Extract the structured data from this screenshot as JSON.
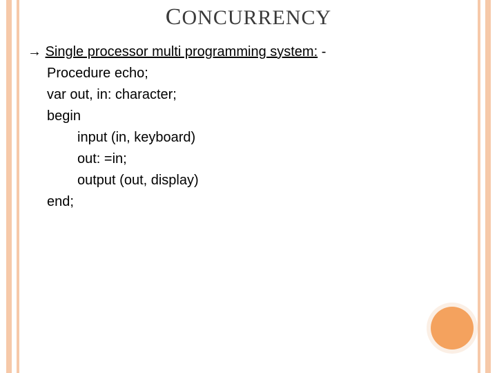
{
  "title": {
    "firstChar": "C",
    "rest": "ONCURRENCY"
  },
  "bullet_arrow": "→",
  "heading": "Single processor multi programming system:",
  "heading_suffix": " -",
  "lines": {
    "l1": "Procedure echo;",
    "l2": "var out, in: character;",
    "l3": "begin",
    "l4": "input (in, keyboard)",
    "l5": "out: =in;",
    "l6": "output (out, display)",
    "l7": "end;"
  }
}
